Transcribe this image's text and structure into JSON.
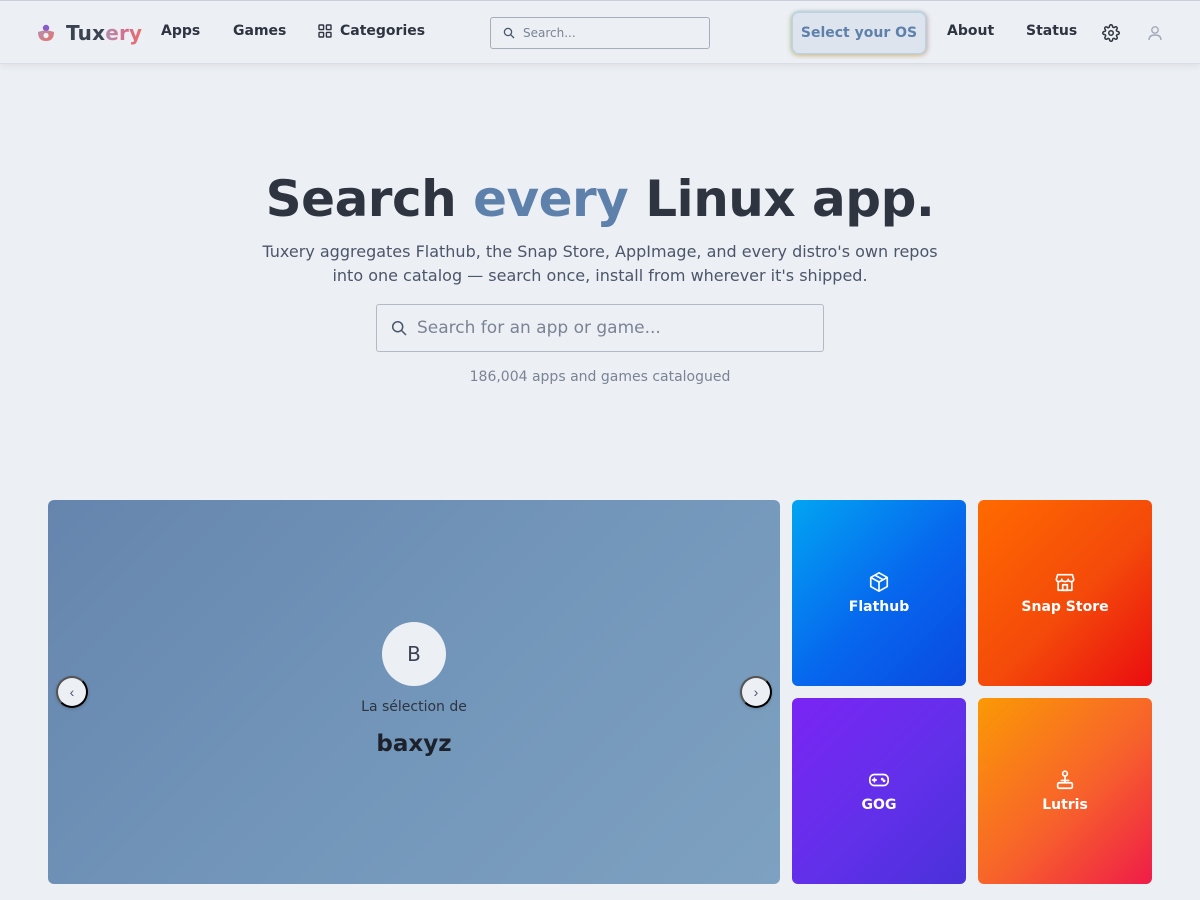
{
  "brand": {
    "name_part1": "Tux",
    "name_part2": "ery",
    "gradient": [
      "#b48ead",
      "#d96a8a",
      "#e8726a"
    ]
  },
  "nav": {
    "apps": "Apps",
    "games": "Games",
    "categories": "Categories",
    "about": "About",
    "status": "Status"
  },
  "header_search": {
    "placeholder": "Search..."
  },
  "os_button": {
    "label": "Select your OS"
  },
  "header_icons": [
    "grid-icon",
    "search-icon",
    "gear-icon",
    "user-icon"
  ],
  "hero": {
    "title_before": "Search ",
    "title_accent": "every",
    "title_after": " Linux app.",
    "subtitle": "Tuxery aggregates Flathub, the Snap Store, AppImage, and every distro's own repos into one catalog — search once, install from wherever it's shipped.",
    "search_placeholder": "Search for an app or game...",
    "count_text": "186,004 apps and games catalogued"
  },
  "carousel": {
    "avatar_initial": "B",
    "kicker": "La sélection de",
    "name": "baxyz",
    "prev_label": "‹",
    "next_label": "›"
  },
  "sources": [
    {
      "label": "Flathub",
      "icon": "package-icon"
    },
    {
      "label": "Snap Store",
      "icon": "store-icon"
    },
    {
      "label": "GOG",
      "icon": "gamepad-icon"
    },
    {
      "label": "Lutris",
      "icon": "joystick-icon"
    }
  ],
  "colors": {
    "background": "#eceff4",
    "text": "#2e3440",
    "accent": "#5e81ac",
    "flathub": "#0766ee",
    "snap": "#f44a0a",
    "gog": "#6230ea",
    "lutris": "#f7622b"
  }
}
